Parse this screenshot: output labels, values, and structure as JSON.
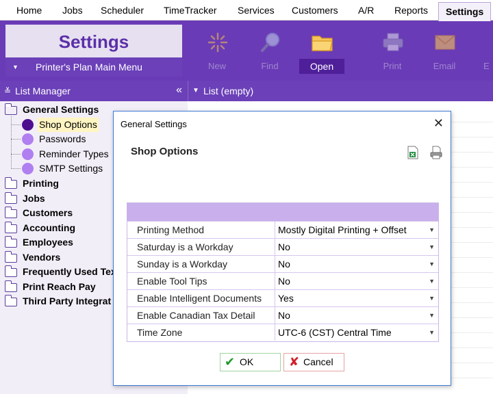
{
  "menubar": {
    "items": [
      "Home",
      "Jobs",
      "Scheduler",
      "TimeTracker",
      "Services",
      "Customers",
      "A/R",
      "Reports",
      "Settings"
    ],
    "active": "Settings"
  },
  "ribbon": {
    "title": "Settings",
    "main_menu": "Printer's Plan Main Menu",
    "buttons": [
      {
        "label": "New",
        "icon": "sparkle-icon",
        "enabled": false
      },
      {
        "label": "Find",
        "icon": "magnifier-icon",
        "enabled": false
      },
      {
        "label": "Open",
        "icon": "folder-icon",
        "enabled": true
      },
      {
        "label": "Print",
        "icon": "printer-icon",
        "enabled": false
      },
      {
        "label": "Email",
        "icon": "envelope-icon",
        "enabled": false
      },
      {
        "label": "E",
        "icon": "",
        "enabled": false
      }
    ],
    "colors": {
      "bar": "#6a3bb7",
      "title": "#5b2fa8",
      "active": "#4f1f9a"
    }
  },
  "list_manager": {
    "header": "List Manager",
    "collapse": "«",
    "tree": [
      {
        "label": "General Settings",
        "open": true,
        "children": [
          "Shop Options",
          "Passwords",
          "Reminder Types",
          "SMTP Settings"
        ],
        "selected_child": "Shop Options"
      },
      {
        "label": "Printing"
      },
      {
        "label": "Jobs"
      },
      {
        "label": "Customers"
      },
      {
        "label": "Accounting"
      },
      {
        "label": "Employees"
      },
      {
        "label": "Vendors"
      },
      {
        "label": "Frequently Used Tex"
      },
      {
        "label": "Print Reach Pay"
      },
      {
        "label": "Third Party Integrat"
      }
    ]
  },
  "list_panel": {
    "header": "List (empty)"
  },
  "dialog": {
    "title": "General Settings",
    "close": "✕",
    "heading": "Shop Options",
    "icons": [
      "excel-export-icon",
      "print-preview-icon"
    ],
    "rows": [
      {
        "name": "Printing Method",
        "value": "Mostly Digital Printing + Offset"
      },
      {
        "name": "Saturday is a Workday",
        "value": "No"
      },
      {
        "name": "Sunday is a Workday",
        "value": "No"
      },
      {
        "name": "Enable Tool Tips",
        "value": "No"
      },
      {
        "name": "Enable Intelligent Documents",
        "value": "Yes"
      },
      {
        "name": "Enable Canadian Tax Detail",
        "value": "No"
      },
      {
        "name": "Time Zone",
        "value": "UTC-6 (CST) Central Time"
      }
    ],
    "ok": "OK",
    "cancel": "Cancel"
  }
}
